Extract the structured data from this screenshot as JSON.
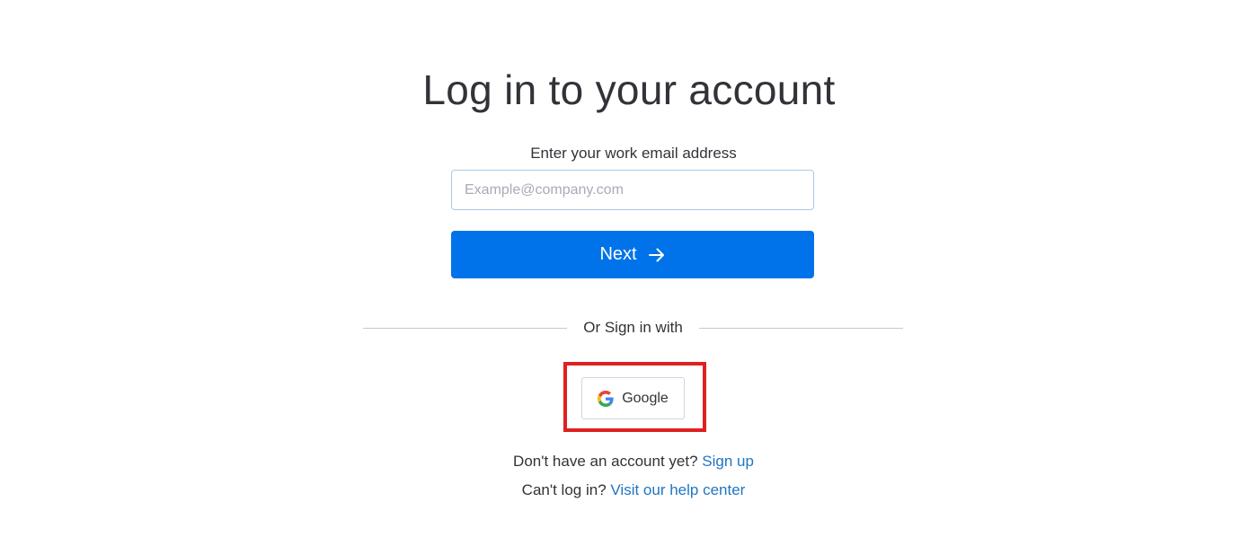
{
  "page": {
    "title": "Log in to your account"
  },
  "email": {
    "label": "Enter your work email address",
    "placeholder": "Example@company.com",
    "value": ""
  },
  "next_button": {
    "label": "Next",
    "icon": "arrow-right-icon",
    "color": "#0073ea"
  },
  "divider": {
    "text": "Or Sign in with"
  },
  "sso": {
    "google_label": "Google",
    "icon": "google-logo-icon",
    "highlight_color": "#e02020"
  },
  "footer": {
    "signup_prompt": "Don't have an account yet?",
    "signup_link": "Sign up",
    "help_prompt": "Can't log in?",
    "help_link": "Visit our help center",
    "link_color": "#1f76c2"
  }
}
